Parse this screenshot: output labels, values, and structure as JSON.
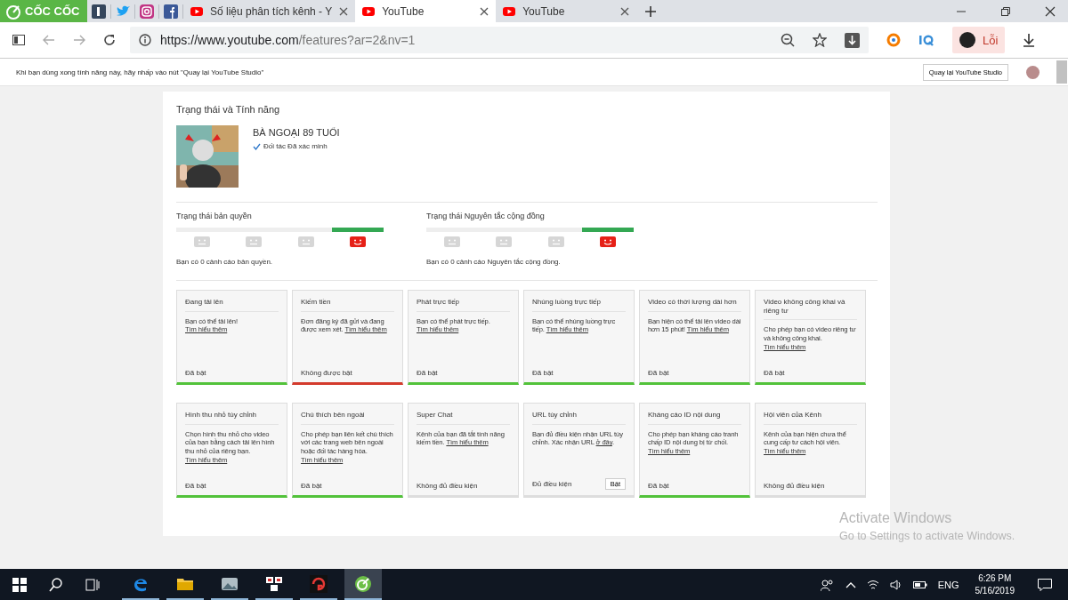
{
  "browser": {
    "brand": "CỐC CỐC",
    "pinned_tabs": [
      {
        "kind": "tumblr"
      },
      {
        "kind": "twitter"
      },
      {
        "kind": "instagram"
      },
      {
        "kind": "facebook"
      }
    ],
    "tabs": [
      {
        "title": "Số liệu phân tích kênh - Y",
        "selected": false
      },
      {
        "title": "YouTube",
        "selected": true
      },
      {
        "title": "YouTube",
        "selected": false
      }
    ],
    "url_host": "https://www.youtube.com",
    "url_path": "/features?ar=2&nv=1",
    "profile_label": "Lỗi"
  },
  "info_bar": {
    "message": "Khi bạn dùng xong tính năng này, hãy nhấp vào nút \"Quay lại YouTube Studio\"",
    "button": "Quay lại YouTube Studio"
  },
  "panel": {
    "title": "Trạng thái và Tính năng",
    "channel_name": "BÀ NGOẠI 89 TUỔI",
    "verified": "Đối tác Đã xác minh",
    "meters": [
      {
        "title": "Trạng thái bản quyền",
        "faces": [
          {
            "selected": false
          },
          {
            "selected": false
          },
          {
            "selected": false
          },
          {
            "selected": true
          }
        ],
        "note": "Bạn có 0 cảnh cáo bản quyền."
      },
      {
        "title": "Trạng thái Nguyên tắc cộng đồng",
        "faces": [
          {
            "selected": false
          },
          {
            "selected": false
          },
          {
            "selected": false
          },
          {
            "selected": true
          }
        ],
        "note": "Bạn có 0 cảnh cáo Nguyên tắc cộng đồng."
      }
    ],
    "features": [
      {
        "title": "Đang tải lên",
        "text": "Bạn có thể tải lên! ",
        "link": "Tìm hiểu thêm",
        "status": "Đã bật",
        "kind": "on"
      },
      {
        "title": "Kiếm tiền",
        "text": "Đơn đăng ký đã gửi và đang được xem xét. ",
        "link": "Tìm hiểu thêm",
        "status": "Không được bật",
        "kind": "off"
      },
      {
        "title": "Phát trực tiếp",
        "text": "Bạn có thể phát trực tiếp. ",
        "link": "Tìm hiểu thêm",
        "status": "Đã bật",
        "kind": "on"
      },
      {
        "title": "Nhúng luồng trực tiếp",
        "text": "Bạn có thể nhúng luồng trực tiếp. ",
        "link": "Tìm hiểu thêm",
        "status": "Đã bật",
        "kind": "on"
      },
      {
        "title": "Video có thời lượng dài hơn",
        "text": "Bạn hiện có thể tải lên video dài hơn 15 phút! ",
        "link": "Tìm hiểu thêm",
        "status": "Đã bật",
        "kind": "on"
      },
      {
        "title": "Video không công khai và riêng tư",
        "text": "Cho phép bạn có video riêng tư và không công khai. ",
        "link": "Tìm hiểu thêm",
        "status": "Đã bật",
        "kind": "on"
      },
      {
        "title": "Hình thu nhỏ tùy chỉnh",
        "text": "Chọn hình thu nhỏ cho video của bạn bằng cách tải lên hình thu nhỏ của riêng bạn. ",
        "link": "Tìm hiểu thêm",
        "status": "Đã bật",
        "kind": "on"
      },
      {
        "title": "Chú thích bên ngoài",
        "text": "Cho phép bạn liên kết chú thích với các trang web bên ngoài hoặc đối tác hàng hóa. ",
        "link": "Tìm hiểu thêm",
        "status": "Đã bật",
        "kind": "on"
      },
      {
        "title": "Super Chat",
        "text": "Kênh của bạn đã tắt tính năng kiếm tiền. ",
        "link": "Tìm hiểu thêm",
        "status": "Không đủ điều kiện",
        "kind": "none"
      },
      {
        "title": "URL tùy chỉnh",
        "text": "Bạn đủ điều kiện nhận URL tùy chỉnh. Xác nhận URL ",
        "link": "ở đây",
        "after": ".",
        "status": "Đủ điều kiện",
        "kind": "none",
        "button": "Bật"
      },
      {
        "title": "Kháng cáo ID nội dung",
        "text": "Cho phép bạn kháng cáo tranh chấp ID nội dung bị từ chối. ",
        "link": "Tìm hiểu thêm",
        "status": "Đã bật",
        "kind": "on"
      },
      {
        "title": "Hội viên của Kênh",
        "text": "Kênh của bạn hiện chưa thể cung cấp tư cách hội viên. ",
        "link": "Tìm hiểu thêm",
        "status": "Không đủ điều kiện",
        "kind": "none"
      }
    ]
  },
  "activation": {
    "title": "Activate Windows",
    "subtitle": "Go to Settings to activate Windows."
  },
  "taskbar": {
    "apps": [
      {
        "kind": "edge",
        "selected": false
      },
      {
        "kind": "folder",
        "selected": false
      },
      {
        "kind": "photos",
        "selected": false
      },
      {
        "kind": "mail",
        "selected": false
      },
      {
        "kind": "game",
        "selected": false
      },
      {
        "kind": "coccoc",
        "selected": true
      }
    ],
    "language": "ENG",
    "time": "6:26 PM",
    "date": "5/16/2019"
  }
}
